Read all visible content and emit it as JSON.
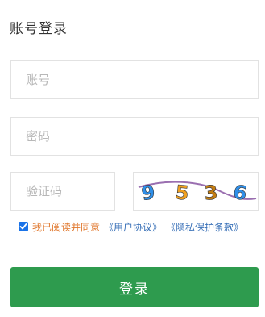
{
  "page": {
    "title": "账号登录"
  },
  "form": {
    "account_placeholder": "账号",
    "password_placeholder": "密码",
    "captcha_placeholder": "验证码"
  },
  "captcha": {
    "digits": [
      "9",
      "5",
      "3",
      "6"
    ],
    "digit_colors": [
      "#2f8fe8",
      "#f0a020",
      "#c47d12",
      "#2f8fe8"
    ],
    "line_color": "#9a6fb0"
  },
  "agreement": {
    "checked": true,
    "text": "我已阅读并同意",
    "user_agreement": "《用户协议》",
    "privacy_terms": "《隐私保护条款》"
  },
  "login_button": "登录"
}
